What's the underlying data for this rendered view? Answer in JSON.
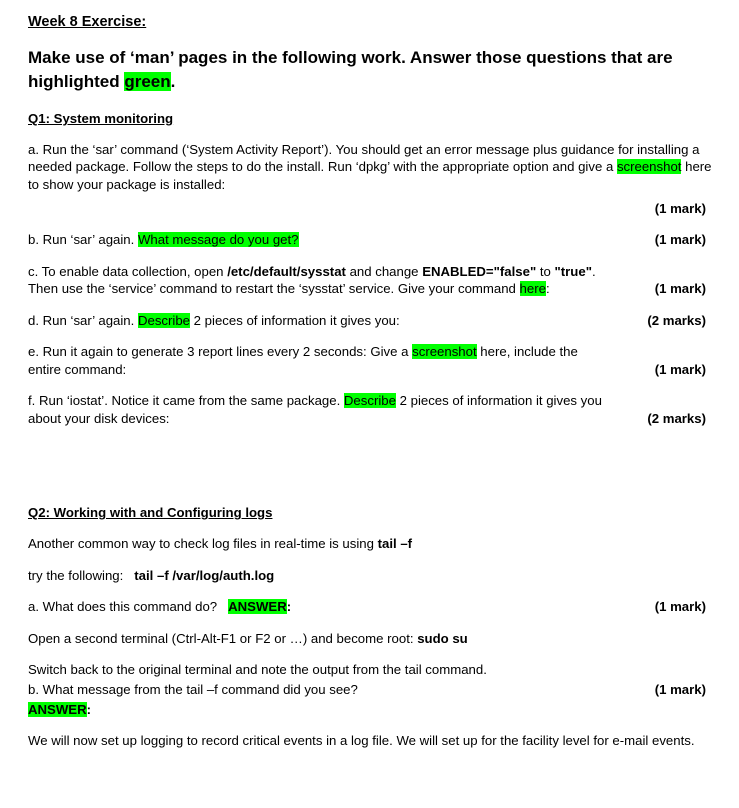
{
  "document": {
    "title": "Week 8 Exercise:",
    "lead_parts": {
      "before": "Make use of ‘man’ pages in the following work. Answer those questions that are highlighted ",
      "highlight": "green",
      "after": "."
    }
  },
  "q1": {
    "heading": "Q1: System monitoring",
    "items": [
      {
        "id": "a",
        "text_1": "a. Run the ‘sar’ command (‘System Activity Report’). You should get an error message plus guidance for installing a needed package. Follow the steps to do the install. Run ‘dpkg’ with the appropriate option and give a ",
        "highlight": "screenshot",
        "text_2": " here to show your package is installed:",
        "marks": "(1 mark)"
      },
      {
        "id": "b",
        "text_1": "b. Run ‘sar’ again. ",
        "highlight": "What message do you get?",
        "text_2": "",
        "marks": "(1 mark)"
      },
      {
        "id": "c",
        "text_1": "c. To enable data collection, open ",
        "bold_1": "/etc/default/sysstat",
        "text_2": " and change ",
        "bold_2": "ENABLED=\"false\"",
        "text_3": " to ",
        "bold_3": "\"true\"",
        "text_4": ". Then use the ‘service’ command to restart the ‘sysstat’ service. Give your command ",
        "highlight": "here",
        "text_5": ":",
        "marks": "(1 mark)"
      },
      {
        "id": "d",
        "text_1": "d. Run ‘sar’ again. ",
        "highlight": "Describe",
        "text_2": " 2 pieces of information it gives you:",
        "marks": "(2 marks)"
      },
      {
        "id": "e",
        "text_1": "e. Run it again to generate 3 report lines every 2 seconds: Give a ",
        "highlight": "screenshot",
        "text_2": " here, include the entire command:",
        "marks": "(1 mark)"
      },
      {
        "id": "f",
        "text_1": "f. Run ‘iostat’. Notice it came from the same package. ",
        "highlight": "Describe",
        "text_2": " 2 pieces of information it gives you about your disk devices:",
        "marks": "(2 marks)"
      }
    ]
  },
  "q2": {
    "heading": "Q2: Working with and Configuring logs",
    "intro_1_text": "Another common way to check log files in real-time is using ",
    "intro_1_bold": "tail –f",
    "intro_2_text": "try the following:   ",
    "intro_2_bold": "tail –f /var/log/auth.log",
    "item_a": {
      "text_1": "a. What does this command do?   ",
      "highlight": "ANSWER",
      "text_2": ":",
      "marks": "(1 mark)"
    },
    "terminal_line_text": "Open a second terminal (Ctrl-Alt-F1 or F2 or …) and become root: ",
    "terminal_line_bold": "sudo su",
    "switch_line": "Switch back to the original terminal and note the output from the tail command.",
    "item_b": {
      "text_1": "b. What message from the tail –f command did you see?",
      "marks": "(1 mark)",
      "answer_highlight": "ANSWER",
      "answer_suffix": ":"
    },
    "closing": "We will now set up logging to record critical events in a log file. We will set up for the facility level for e-mail events."
  },
  "colors": {
    "highlight": "#00ff00",
    "text": "#000000",
    "background": "#ffffff"
  }
}
